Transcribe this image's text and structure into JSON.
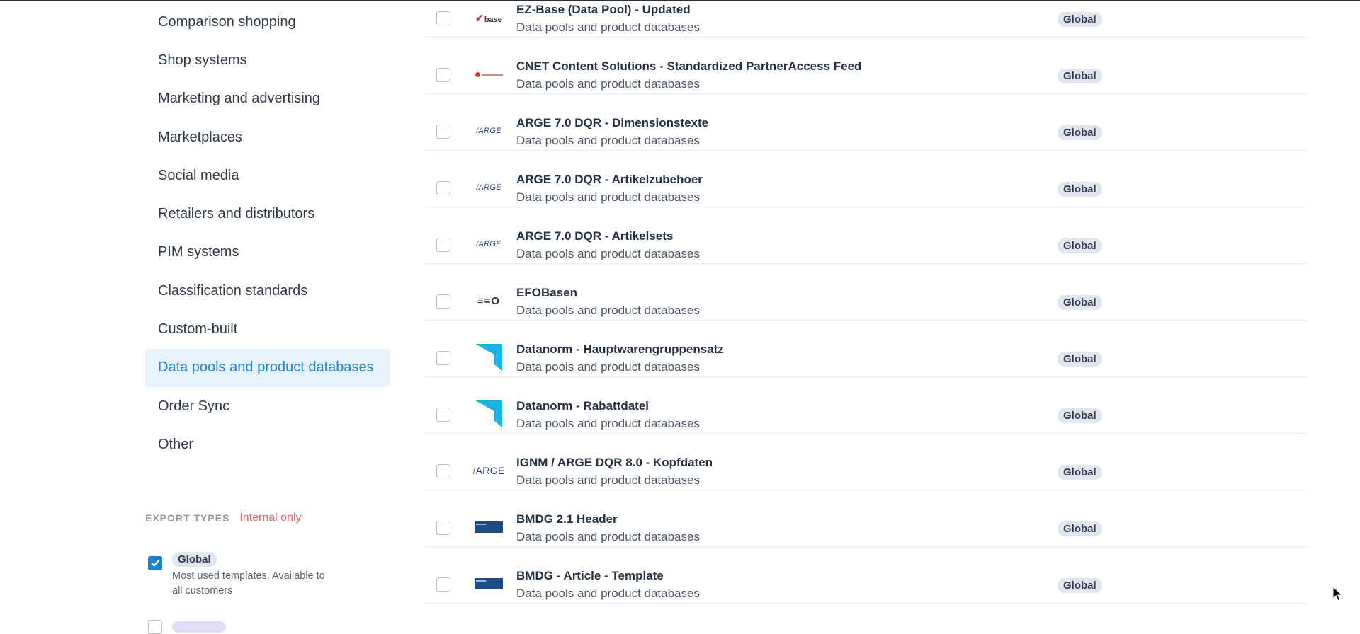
{
  "sidebar": {
    "categories": [
      {
        "label": "Comparison shopping",
        "active": false
      },
      {
        "label": "Shop systems",
        "active": false
      },
      {
        "label": "Marketing and advertising",
        "active": false
      },
      {
        "label": "Marketplaces",
        "active": false
      },
      {
        "label": "Social media",
        "active": false
      },
      {
        "label": "Retailers and distributors",
        "active": false
      },
      {
        "label": "PIM systems",
        "active": false
      },
      {
        "label": "Classification standards",
        "active": false
      },
      {
        "label": "Custom-built",
        "active": false
      },
      {
        "label": "Data pools and product databases",
        "active": true
      },
      {
        "label": "Order Sync",
        "active": false
      },
      {
        "label": "Other",
        "active": false
      }
    ],
    "export_types": {
      "title": "EXPORT TYPES",
      "note": "Internal only",
      "types": [
        {
          "badge": "Global",
          "description": "Most used templates. Available to all customers",
          "checked": true
        }
      ]
    }
  },
  "templates": [
    {
      "title": "EZ-Base (Data Pool) - Updated",
      "category": "Data pools and product databases",
      "badge": "Global",
      "logo": "ezbase-logo",
      "logo_text": "base",
      "checked": false
    },
    {
      "title": "CNET Content Solutions - Standardized PartnerAccess Feed",
      "category": "Data pools and product databases",
      "badge": "Global",
      "logo": "cnet-logo",
      "checked": false
    },
    {
      "title": "ARGE 7.0 DQR - Dimensionstexte",
      "category": "Data pools and product databases",
      "badge": "Global",
      "logo": "arge-logo",
      "logo_text": "ARGE",
      "checked": false
    },
    {
      "title": "ARGE 7.0 DQR - Artikelzubehoer",
      "category": "Data pools and product databases",
      "badge": "Global",
      "logo": "arge-logo",
      "logo_text": "ARGE",
      "checked": false
    },
    {
      "title": "ARGE 7.0 DQR - Artikelsets",
      "category": "Data pools and product databases",
      "badge": "Global",
      "logo": "arge-logo",
      "logo_text": "ARGE",
      "checked": false
    },
    {
      "title": "EFOBasen",
      "category": "Data pools and product databases",
      "badge": "Global",
      "logo": "efo-logo",
      "logo_text": "≡=O",
      "checked": false
    },
    {
      "title": "Datanorm - Hauptwarengruppensatz",
      "category": "Data pools and product databases",
      "badge": "Global",
      "logo": "datanorm-logo",
      "checked": false
    },
    {
      "title": "Datanorm - Rabattdatei",
      "category": "Data pools and product databases",
      "badge": "Global",
      "logo": "datanorm-logo",
      "checked": false
    },
    {
      "title": "IGNM / ARGE DQR 8.0 - Kopfdaten",
      "category": "Data pools and product databases",
      "badge": "Global",
      "logo": "arge-logo-large",
      "logo_text": "ARGE",
      "checked": false
    },
    {
      "title": "BMDG 2.1 Header",
      "category": "Data pools and product databases",
      "badge": "Global",
      "logo": "bmdg-logo",
      "checked": false
    },
    {
      "title": "BMDG - Article - Template",
      "category": "Data pools and product databases",
      "badge": "Global",
      "logo": "bmdg-logo",
      "checked": false
    }
  ],
  "colors": {
    "accent": "#1c86c8",
    "active_bg": "#e8f2fc",
    "badge_bg": "#e1e6ee",
    "internal_note": "#e2626b",
    "checkbox_checked": "#1a81cc",
    "datanorm_cyan": "#1ab3e8"
  }
}
